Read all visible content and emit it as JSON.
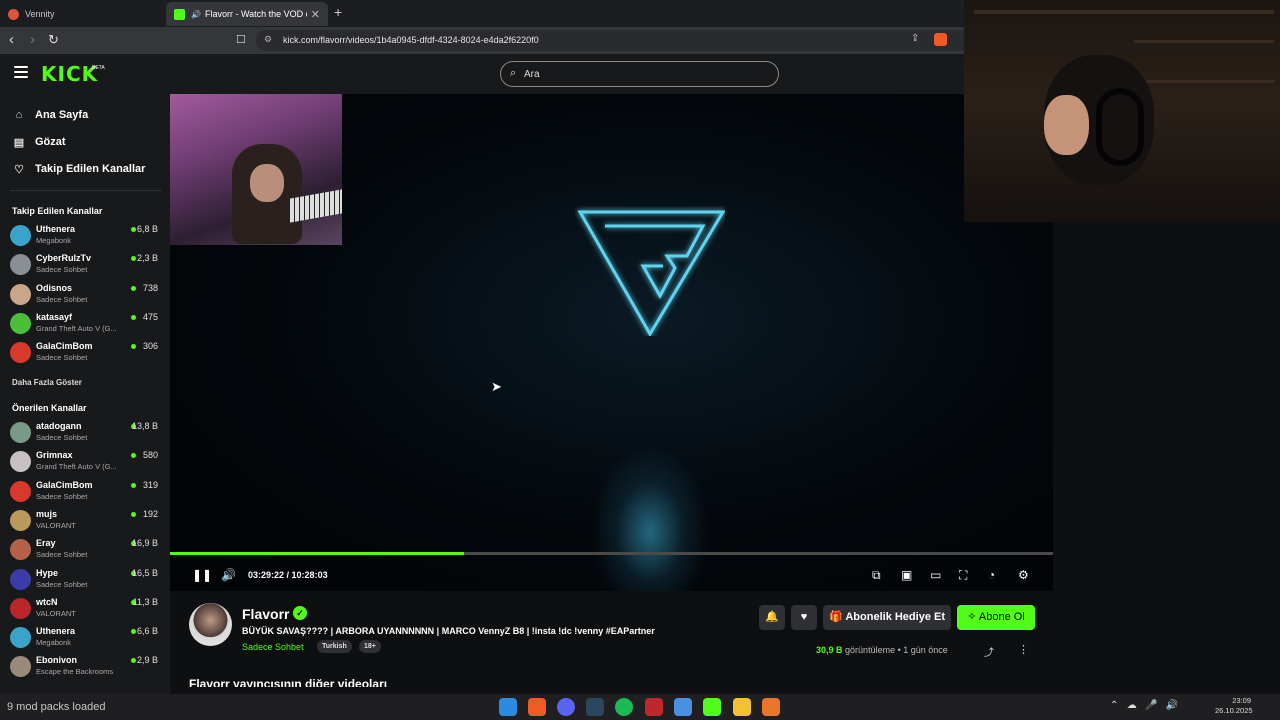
{
  "browser": {
    "tabs": [
      {
        "title": "Vennity",
        "active": false
      },
      {
        "title": "Flavorr - Watch the VOD on Kick",
        "active": true
      }
    ],
    "new_tab": "+",
    "url": "kick.com/flavorr/videos/1b4a0945-dfdf-4324-8024-e4da2f6220f0"
  },
  "header": {
    "logo": "KICK",
    "beta": "BETA",
    "search_placeholder": "Ara"
  },
  "sidebar": {
    "nav": [
      {
        "label": "Ana Sayfa",
        "icon": "home-icon"
      },
      {
        "label": "Gözat",
        "icon": "browse-icon"
      },
      {
        "label": "Takip Edilen Kanallar",
        "icon": "heart-icon"
      }
    ],
    "followed_title": "Takip Edilen Kanallar",
    "followed": [
      {
        "name": "Uthenera",
        "category": "Megabonk",
        "viewers": "6,8 B",
        "color": "#3aa3c9"
      },
      {
        "name": "CyberRulzTv",
        "category": "Sadece Sohbet",
        "viewers": "2,3 B",
        "color": "#8a8f96"
      },
      {
        "name": "Odisnos",
        "category": "Sadece Sohbet",
        "viewers": "738",
        "color": "#c9a58a"
      },
      {
        "name": "katasayf",
        "category": "Grand Theft Auto V (G...",
        "viewers": "475",
        "color": "#4bbf3a"
      },
      {
        "name": "GalaCimBom",
        "category": "Sadece Sohbet",
        "viewers": "306",
        "color": "#d8392b"
      }
    ],
    "show_more": "Daha Fazla Göster",
    "recommended_title": "Önerilen Kanallar",
    "recommended": [
      {
        "name": "atadogann",
        "category": "Sadece Sohbet",
        "viewers": "13,8 B",
        "color": "#7a9a88"
      },
      {
        "name": "Grimnax",
        "category": "Grand Theft Auto V (G...",
        "viewers": "580",
        "color": "#c7c0c0"
      },
      {
        "name": "GalaCimBom",
        "category": "Sadece Sohbet",
        "viewers": "319",
        "color": "#d8392b"
      },
      {
        "name": "mujs",
        "category": "VALORANT",
        "viewers": "192",
        "color": "#b99a5a"
      },
      {
        "name": "Eray",
        "category": "Sadece Sohbet",
        "viewers": "16,9 B",
        "color": "#b56048"
      },
      {
        "name": "Hype",
        "category": "Sadece Sohbet",
        "viewers": "16,5 B",
        "color": "#3c3ca8"
      },
      {
        "name": "wtcN",
        "category": "VALORANT",
        "viewers": "11,3 B",
        "color": "#b8262a"
      },
      {
        "name": "Uthenera",
        "category": "Megabonk",
        "viewers": "6,6 B",
        "color": "#3aa3c9"
      },
      {
        "name": "Ebonivon",
        "category": "Escape the Backrooms",
        "viewers": "2,9 B",
        "color": "#9a8a7a"
      }
    ]
  },
  "player": {
    "current_time": "03:29:22",
    "duration": "10:28:03",
    "progress_fraction": 0.333
  },
  "channel": {
    "name": "Flavorr",
    "title": "BÜYÜK SAVAŞ???? | ARBORA UYANNNNNN | MARCO VennyZ B8 | !insta !dc !venny #EAPartner",
    "category": "Sadece Sohbet",
    "tags": [
      "Turkish",
      "18+"
    ],
    "gift_label": "Abonelik Hediye Et",
    "subscribe_label": "Abone Ol",
    "views": "30,9 B",
    "views_suffix": "görüntüleme",
    "age": "1 gün önce",
    "other_videos": "Flavorr yayıncısının diğer videoları"
  },
  "taskbar": {
    "status": "9 mod packs loaded",
    "time": "23:09",
    "date": "26.10.2025"
  },
  "colors": {
    "accent": "#53fc18",
    "bg": "#0e0f11",
    "surface": "#18191b"
  }
}
